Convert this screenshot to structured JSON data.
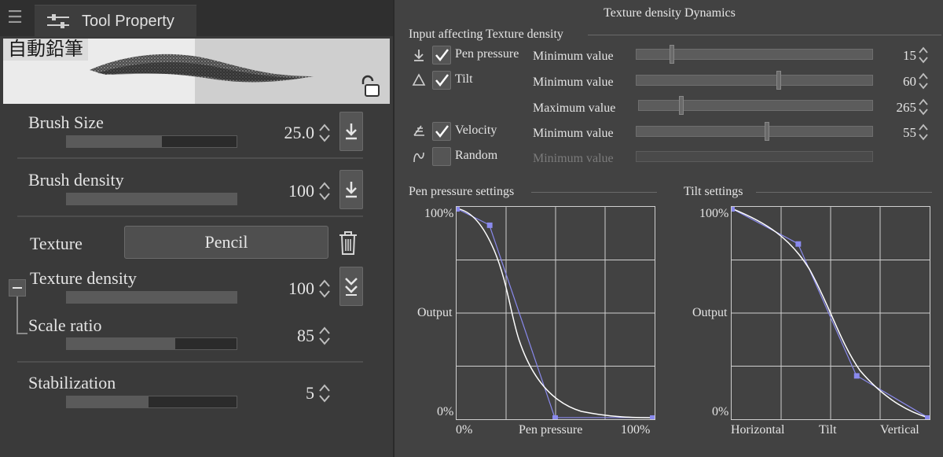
{
  "tool_property": {
    "tab_label": "Tool Property",
    "preset_name": "自動鉛筆",
    "properties": [
      {
        "label": "Brush Size",
        "value": "25.0",
        "fill": 0.56
      },
      {
        "label": "Brush density",
        "value": "100",
        "fill": 1.0
      },
      {
        "label": "Texture density",
        "value": "100",
        "fill": 1.0
      },
      {
        "label": "Scale ratio",
        "value": "85",
        "fill": 0.64
      },
      {
        "label": "Stabilization",
        "value": "5",
        "fill": 0.48
      }
    ],
    "texture_label": "Texture",
    "texture_value": "Pencil"
  },
  "dynamics": {
    "title": "Texture density Dynamics",
    "inputs_legend": "Input affecting Texture density",
    "inputs": [
      {
        "name": "Pen pressure",
        "checked": true,
        "enabled": true,
        "rows": [
          {
            "label": "Minimum value",
            "value": "15",
            "thumb": 0.15
          }
        ]
      },
      {
        "name": "Tilt",
        "checked": true,
        "enabled": true,
        "rows": [
          {
            "label": "Minimum value",
            "value": "60",
            "thumb": 0.6
          },
          {
            "label": "Maximum value",
            "value": "265",
            "thumb": 0.18
          }
        ]
      },
      {
        "name": "Velocity",
        "checked": true,
        "enabled": true,
        "rows": [
          {
            "label": "Minimum value",
            "value": "55",
            "thumb": 0.55
          }
        ]
      },
      {
        "name": "Random",
        "checked": false,
        "enabled": false,
        "rows": [
          {
            "label": "Minimum value",
            "value": "",
            "thumb": null
          }
        ]
      }
    ],
    "pen_graph": {
      "title": "Pen pressure settings",
      "y_top": "100%",
      "y_mid": "Output",
      "y_bottom": "0%",
      "x_left": "0%",
      "x_mid": "Pen pressure",
      "x_right": "100%"
    },
    "tilt_graph": {
      "title": "Tilt settings",
      "y_top": "100%",
      "y_mid": "Output",
      "y_bottom": "0%",
      "x_left": "Horizontal",
      "x_mid": "Tilt",
      "x_right": "Vertical"
    },
    "colors": {
      "curve": "#ffffff",
      "control": "#8a8aee",
      "grid": "#d0d0d0"
    }
  }
}
